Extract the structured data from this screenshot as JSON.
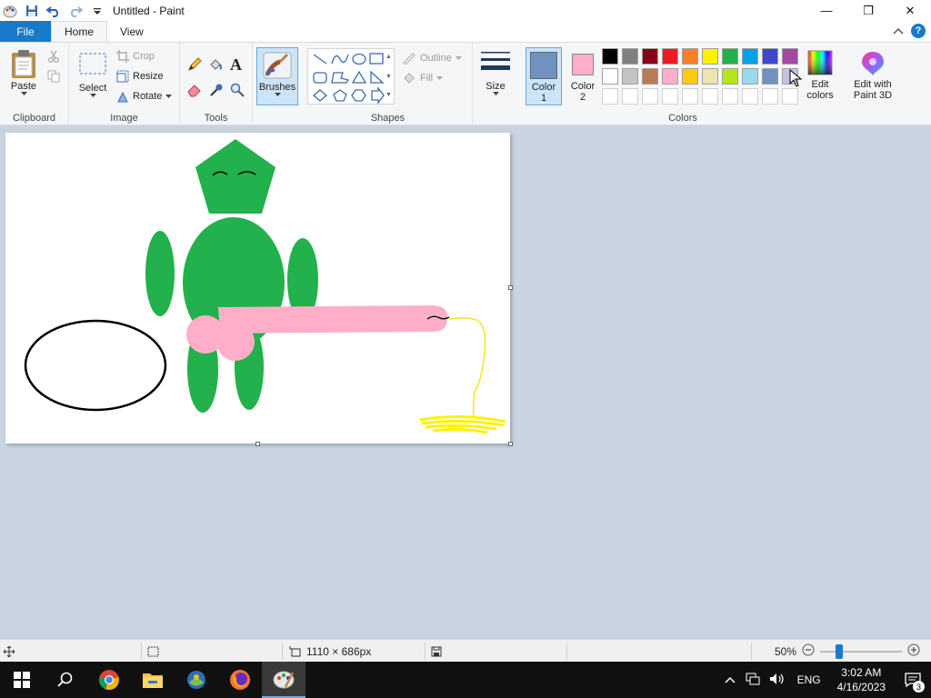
{
  "window": {
    "title": "Untitled - Paint",
    "minimize": "—",
    "restore": "❐",
    "close": "✕"
  },
  "tabs": [
    {
      "label": "File"
    },
    {
      "label": "Home"
    },
    {
      "label": "View"
    }
  ],
  "ribbon": {
    "clipboard": {
      "group_label": "Clipboard",
      "paste_label": "Paste"
    },
    "image": {
      "group_label": "Image",
      "select_label": "Select",
      "crop_label": "Crop",
      "resize_label": "Resize",
      "rotate_label": "Rotate"
    },
    "tools": {
      "group_label": "Tools"
    },
    "brushes": {
      "label": "Brushes"
    },
    "shapes": {
      "group_label": "Shapes",
      "outline_label": "Outline",
      "fill_label": "Fill"
    },
    "size": {
      "label": "Size"
    },
    "colors": {
      "group_label": "Colors",
      "color1_label": "Color",
      "color1_num": "1",
      "color2_label": "Color",
      "color2_num": "2",
      "color1_value": "#7092be",
      "color2_value": "#ffaec9",
      "edit_colors_line1": "Edit",
      "edit_colors_line2": "colors",
      "paint3d_line1": "Edit with",
      "paint3d_line2": "Paint 3D",
      "palette_row1": [
        "#000000",
        "#7f7f7f",
        "#880015",
        "#ed1c24",
        "#ff7f27",
        "#fff200",
        "#22b14c",
        "#00a2e8",
        "#3f48cc",
        "#a349a4"
      ],
      "palette_row2": [
        "#ffffff",
        "#c3c3c3",
        "#b97a57",
        "#ffaec9",
        "#ffc90e",
        "#efe4b0",
        "#b5e61d",
        "#99d9ea",
        "#7092be",
        "#c8bfe7"
      ]
    }
  },
  "status": {
    "dimensions": "1110 × 686px",
    "zoom": "50%",
    "zoom_fraction": 0.5
  },
  "taskbar": {
    "lang": "ENG",
    "time": "3:02 AM",
    "date": "4/16/2023",
    "notifications": "3"
  }
}
